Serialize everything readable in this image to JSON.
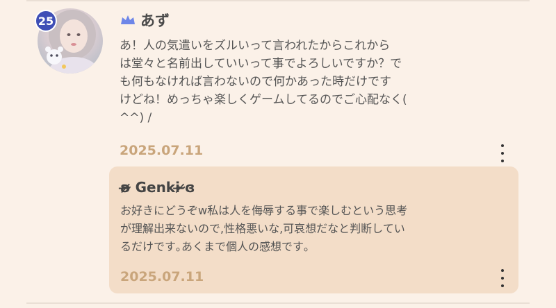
{
  "comment": {
    "level_badge": "25",
    "crown_icon": "crown-icon",
    "crown_color": "#6d86e8",
    "username": "あず",
    "body": "あ！人の気遣いをズルいって言われたからこれから\nは堂々と名前出していいって事でよろしいですか？で\nも何もなければ言わないので何かあった時だけです\nけどね！めっちゃ楽しくゲームしてるのでご心配なく(\n^^) /",
    "date": "2025.07.11",
    "more_icon": "more-vertical-icon"
  },
  "reply": {
    "username": "ʚ̴̶̷̷ Genki ̷̷̶̴ɞ",
    "body": "お好きにどうぞw私は人を侮辱する事で楽しむという思考\nが理解出来ないので,性格悪いな,可哀想だなと判断してい\nるだけです｡あくまで個人の感想です｡",
    "date": "2025.07.11",
    "more_icon": "more-vertical-icon"
  },
  "colors": {
    "background": "#fbf1e8",
    "reply_background": "#f3ddc8",
    "date_color": "#c9a57b",
    "badge_color": "#3f4fb6"
  }
}
